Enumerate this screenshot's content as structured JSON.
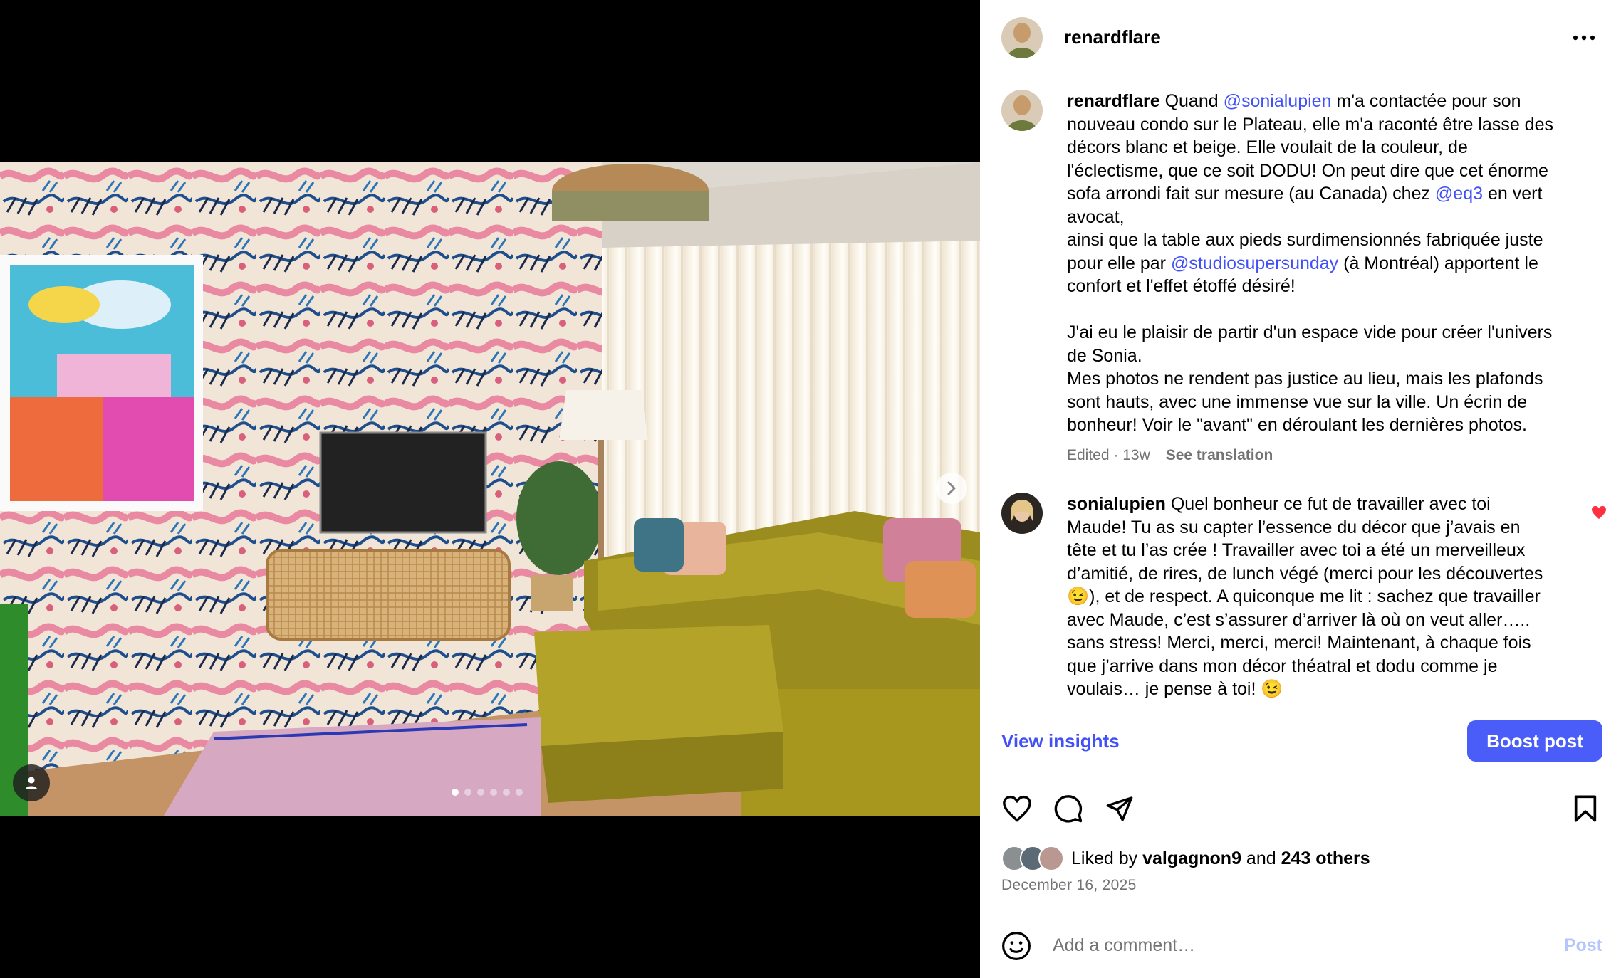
{
  "post": {
    "username": "renardflare",
    "more_icon": "more-horizontal-icon"
  },
  "media": {
    "carousel_count": 6,
    "carousel_active_index": 0
  },
  "caption": {
    "username": "renardflare",
    "parts": [
      {
        "text": "Quand ",
        "mention": false
      },
      {
        "text": "@sonialupien",
        "mention": true
      },
      {
        "text": " m'a contactée pour son\nnouveau condo sur le Plateau, elle m'a raconté être lasse des\ndécors blanc et beige. Elle voulait de la couleur, de\nl'éclectisme, que ce soit DODU! On peut dire que cet énorme\nsofa arrondi fait sur mesure (au Canada) chez ",
        "mention": false
      },
      {
        "text": "@eq3",
        "mention": true
      },
      {
        "text": " en vert\navocat,\nainsi que la table aux pieds surdimensionnés fabriquée juste\npour elle par ",
        "mention": false
      },
      {
        "text": "@studiosupersunday",
        "mention": true
      },
      {
        "text": " (à Montréal) apportent le\nconfort et l'effet étoffé désiré!\n\nJ'ai eu le plaisir de partir d'un espace vide pour créer l'univers\nde Sonia.\nMes photos ne rendent pas justice au lieu, mais les plafonds\nsont hauts, avec une immense vue sur la ville. Un écrin de\nbonheur! Voir le \"avant\" en déroulant les dernières photos.",
        "mention": false
      }
    ],
    "meta_edited": "Edited · 13w",
    "see_translation": "See translation"
  },
  "comment": {
    "username": "sonialupien",
    "text": "Quel bonheur ce fut de travailler avec toi\nMaude! Tu as su capter l’essence du décor que j’avais en\ntête et tu l’as crée ! Travailler avec toi a été un merveilleux\nd’amitié, de rires, de lunch végé (merci pour les découvertes\n😉), et de respect. A quiconque me lit : sachez que travailler\navec Maude, c’est s’assurer d’arriver là où on veut aller…..\nsans stress! Merci, merci, merci! Maintenant, à chaque fois\nque j’arrive dans mon décor théatral et dodu comme je\nvoulais… je pense à toi! 😉",
    "liked": true,
    "like_color": "#ff3040"
  },
  "insights": {
    "view_label": "View insights",
    "boost_label": "Boost post",
    "accent": "#4150f7"
  },
  "likes": {
    "prefix": "Liked by ",
    "first_liker": "valgagnon9",
    "middle": " and ",
    "others": "243 others"
  },
  "date": "December 16, 2025",
  "add_comment": {
    "placeholder": "Add a comment…",
    "post_label": "Post"
  }
}
